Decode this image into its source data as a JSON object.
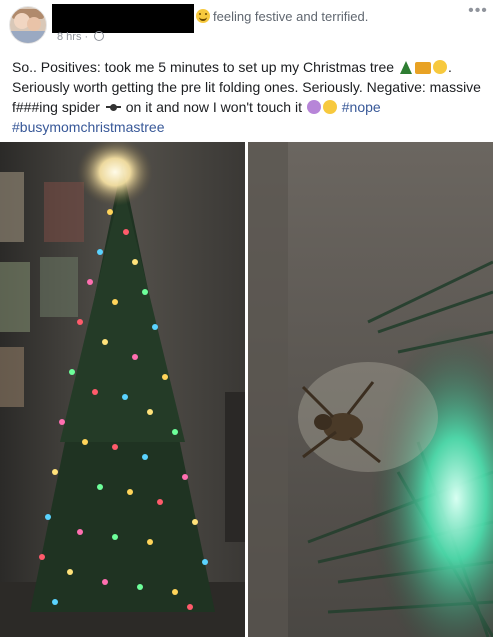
{
  "header": {
    "feeling_text": "feeling festive and terrified.",
    "timestamp": "8 hrs",
    "more_label": "•••"
  },
  "post": {
    "line1_prefix": "So.. Positives: took me 5 minutes to set up my Christmas tree",
    "line2": "Seriously worth getting the pre lit folding ones. Seriously. Negative: massive",
    "line3_a": "f###ing spider",
    "line3_b": "on it and now I won't touch it",
    "hashtag_nope": "#nope",
    "hashtag_busymom": "#busymomchristmastree"
  },
  "icons": {
    "tree": "christmas-tree-icon",
    "crown": "crown-icon",
    "face": "flushed-face-icon",
    "spider": "spider-icon",
    "purple_face": "purple-face-icon",
    "tired_face": "tired-face-icon"
  },
  "colors": {
    "link": "#385898",
    "meta_text": "#606770",
    "body_text": "#1c1e21"
  }
}
